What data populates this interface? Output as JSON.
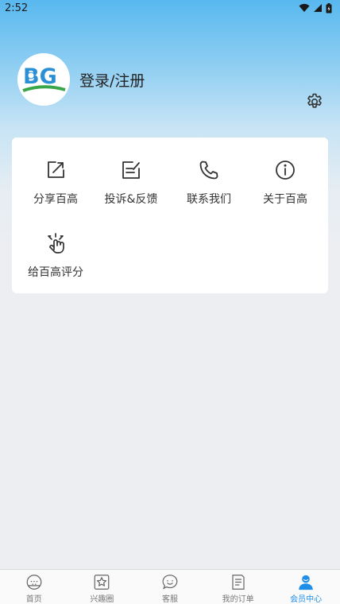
{
  "status_bar": {
    "time": "2:52"
  },
  "profile": {
    "logo_text": "BG",
    "login_label": "登录/注册"
  },
  "menu": {
    "items": [
      {
        "label": "分享百高",
        "icon": "share-icon"
      },
      {
        "label": "投诉&反馈",
        "icon": "edit-note-icon"
      },
      {
        "label": "联系我们",
        "icon": "phone-icon"
      },
      {
        "label": "关于百高",
        "icon": "info-icon"
      },
      {
        "label": "给百高评分",
        "icon": "rate-tap-icon"
      }
    ]
  },
  "tabbar": {
    "active_color": "#1e8ee9",
    "tabs": [
      {
        "label": "首页",
        "icon": "golf-ball-icon"
      },
      {
        "label": "兴趣圈",
        "icon": "star-icon"
      },
      {
        "label": "客服",
        "icon": "chat-smile-icon"
      },
      {
        "label": "我的订单",
        "icon": "order-list-icon"
      },
      {
        "label": "会员中心",
        "icon": "user-icon",
        "active": true
      }
    ]
  }
}
